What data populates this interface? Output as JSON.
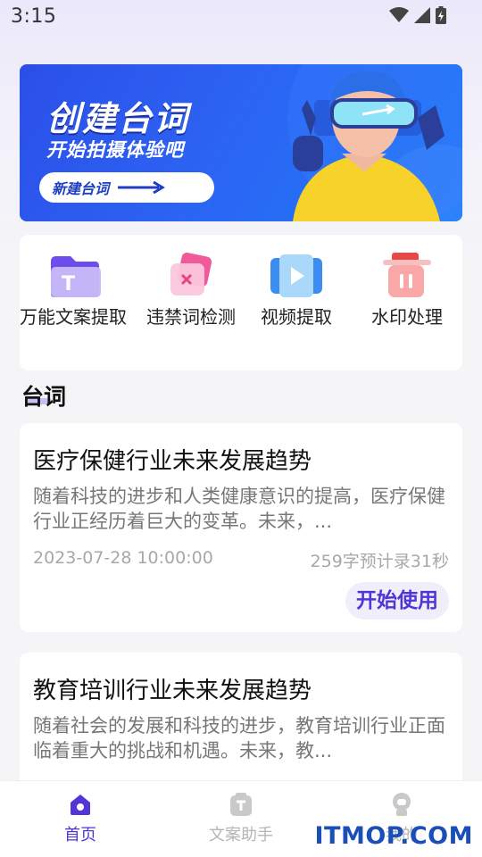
{
  "status_bar": {
    "time": "3:15"
  },
  "banner": {
    "title": "创建台词",
    "subtitle": "开始拍摄体验吧",
    "button_label": "新建台词"
  },
  "tools": [
    {
      "label": "万能文案提取",
      "icon": "folder-text-icon"
    },
    {
      "label": "违禁词检测",
      "icon": "forbidden-word-icon"
    },
    {
      "label": "视频提取",
      "icon": "video-play-icon"
    },
    {
      "label": "水印处理",
      "icon": "watermark-icon"
    }
  ],
  "section": {
    "title": "台词"
  },
  "cards": [
    {
      "title": "医疗保健行业未来发展趋势",
      "desc": "随着科技的进步和人类健康意识的提高，医疗保健行业正经历着巨大的变革。未来，...",
      "date": "2023-07-28 10:00:00",
      "meta": "259字预计录31秒",
      "button": "开始使用"
    },
    {
      "title": "教育培训行业未来发展趋势",
      "desc": "随着社会的发展和科技的进步，教育培训行业正面临着重大的挑战和机遇。未来，教...",
      "date": "",
      "meta": "",
      "button": ""
    }
  ],
  "tabbar": {
    "items": [
      {
        "label": "首页",
        "icon": "home-icon",
        "active": true
      },
      {
        "label": "文案助手",
        "icon": "text-assistant-icon",
        "active": false
      },
      {
        "label": "我的",
        "icon": "profile-icon",
        "active": false
      }
    ]
  },
  "watermark": "ITMOP.COM",
  "colors": {
    "accent": "#5135d6",
    "banner": "#2c5ff0",
    "inactive": "#b5b5b5"
  }
}
